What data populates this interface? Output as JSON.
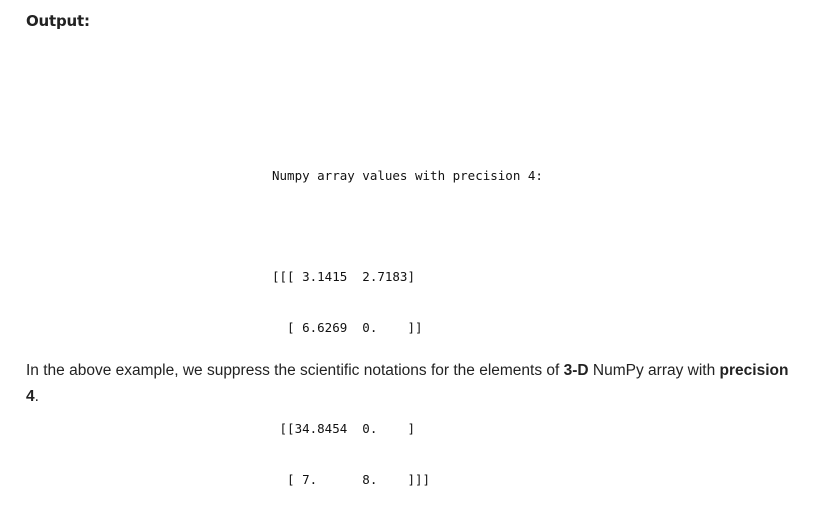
{
  "heading": "Output:",
  "output": {
    "lines": [
      "Numpy array values with precision 4:",
      "",
      "[[[ 3.1415  2.7183]",
      "  [ 6.6269  0.    ]]",
      "",
      " [[34.8454  0.    ]",
      "  [ 7.      8.    ]]]"
    ]
  },
  "caption": {
    "part1": "In the above example, we suppress the scientific notations for the elements of ",
    "bold1": "3-D",
    "part2": " NumPy array with ",
    "bold2": "precision 4",
    "part3": "."
  }
}
